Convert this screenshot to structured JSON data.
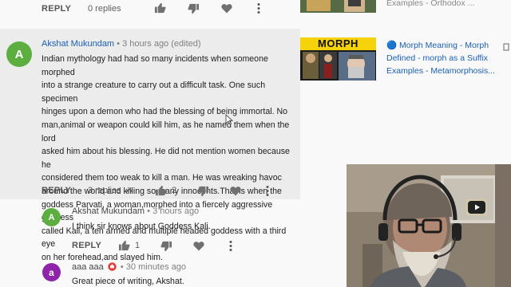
{
  "top_comment_actions": {
    "reply_label": "REPLY",
    "replies_label": "0 replies"
  },
  "main_comment": {
    "avatar_letter": "A",
    "avatar_color": "#5cae3f",
    "author": "Akshat Mukundam",
    "meta": "• 3 hours ago (edited)",
    "text_lines": [
      "Indian mythology had had so many incidents when someone morphed",
      "into a strange creature  to carry out a difficult task. One such specimen",
      "hinges upon a demon who had the blessing of being immortal.  No",
      "man,animal or weapon could kill him, as he named them when the lord",
      "asked him about his blessing. He did not mention women because he",
      "considered them too weak to kill a man. He was wreaking havoc",
      "around the world and killing so many innocents.That is when the",
      "goddess Parvati, a woman,morphed into a fiercely aggressive goddess",
      "called Kali, a ten armed and multiple headed goddess with a third eye",
      "on her forehead,and slayed him."
    ],
    "reply_label": "REPLY",
    "replies_label": "3 replies",
    "like_count": "2"
  },
  "reply_1": {
    "avatar_letter": "A",
    "avatar_color": "#5cae3f",
    "author": "Akshat Mukundam",
    "meta": "• 3 hours ago",
    "text": "I think sir knows about Goddess Kali.",
    "reply_label": "REPLY",
    "like_count": "1"
  },
  "reply_2": {
    "avatar_letter": "a",
    "avatar_color": "#8e24aa",
    "author": "aaa aaa",
    "meta": "• 30 minutes ago",
    "text": "Great piece of writing, Akshat."
  },
  "recommendations": {
    "top_partial_title": "Examples - Orthodox ...",
    "morph_thumb_text": "MORPH",
    "morph_title_lines": [
      "🔵 Morph Meaning - Morph",
      "Defined - morph as a Suffix",
      "Examples - Metamorphosis..."
    ]
  },
  "colors": {
    "link_blue": "#1a5fb4",
    "highlight_bg": "#ececec",
    "page_bg": "#f9f9f9"
  }
}
